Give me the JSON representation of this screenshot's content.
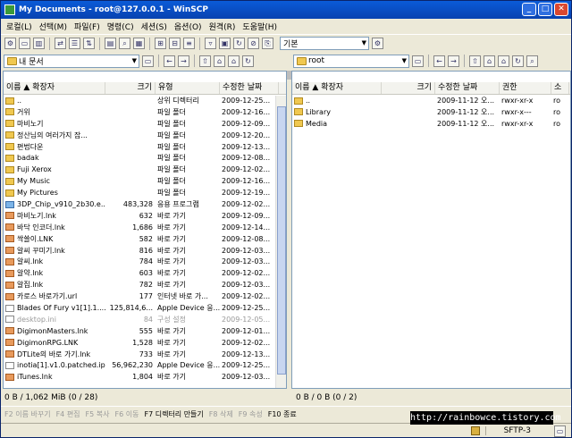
{
  "window": {
    "title": "My Documents - root@127.0.0.1 - WinSCP"
  },
  "menu": [
    "로컬(L)",
    "선택(M)",
    "파일(F)",
    "명령(C)",
    "세션(S)",
    "옵션(O)",
    "원격(R)",
    "도움말(H)"
  ],
  "toolbar": {
    "preset_label": "기본"
  },
  "left_path": {
    "value": "내 문서"
  },
  "right_path": {
    "value": "root"
  },
  "left_panel": {
    "columns": [
      "이름",
      "확장자",
      "크기",
      "유형",
      "수정한 날짜"
    ],
    "rows": [
      {
        "name": "..",
        "size": "",
        "type": "상위 디렉터리",
        "date": "2009-12-25...",
        "icon": "up"
      },
      {
        "name": "거위",
        "size": "",
        "type": "파일 폴더",
        "date": "2009-12-16...",
        "icon": "folder"
      },
      {
        "name": "마비노기",
        "size": "",
        "type": "파일 폴더",
        "date": "2009-12-09...",
        "icon": "folder"
      },
      {
        "name": "정산님의 여러가지 잡...",
        "size": "",
        "type": "파일 폴더",
        "date": "2009-12-20...",
        "icon": "folder"
      },
      {
        "name": "편법다운",
        "size": "",
        "type": "파일 폴더",
        "date": "2009-12-13...",
        "icon": "folder"
      },
      {
        "name": "badak",
        "size": "",
        "type": "파일 폴더",
        "date": "2009-12-08...",
        "icon": "folder"
      },
      {
        "name": "Fuji Xerox",
        "size": "",
        "type": "파일 폴더",
        "date": "2009-12-02...",
        "icon": "folder"
      },
      {
        "name": "My Music",
        "size": "",
        "type": "파일 폴더",
        "date": "2009-12-16...",
        "icon": "folder"
      },
      {
        "name": "My Pictures",
        "size": "",
        "type": "파일 폴더",
        "date": "2009-12-19...",
        "icon": "folder"
      },
      {
        "name": "3DP_Chip_v910_2b30.e...",
        "size": "483,328",
        "type": "응용 프로그램",
        "date": "2009-12-02...",
        "icon": "app"
      },
      {
        "name": "마비노기.lnk",
        "size": "632",
        "type": "바로 가기",
        "date": "2009-12-09...",
        "icon": "lnk"
      },
      {
        "name": "바닥 인코더.lnk",
        "size": "1,686",
        "type": "바로 가기",
        "date": "2009-12-14...",
        "icon": "lnk"
      },
      {
        "name": "싹쓸이.LNK",
        "size": "582",
        "type": "바로 가기",
        "date": "2009-12-08...",
        "icon": "lnk"
      },
      {
        "name": "알씨 꾸미기.lnk",
        "size": "816",
        "type": "바로 가기",
        "date": "2009-12-03...",
        "icon": "lnk"
      },
      {
        "name": "알씨.lnk",
        "size": "784",
        "type": "바로 가기",
        "date": "2009-12-03...",
        "icon": "lnk"
      },
      {
        "name": "알약.lnk",
        "size": "603",
        "type": "바로 가기",
        "date": "2009-12-02...",
        "icon": "lnk"
      },
      {
        "name": "알집.lnk",
        "size": "782",
        "type": "바로 가기",
        "date": "2009-12-03...",
        "icon": "lnk"
      },
      {
        "name": "카로스 바로가기.url",
        "size": "177",
        "type": "인터넷 바로 가...",
        "date": "2009-12-02...",
        "icon": "lnk"
      },
      {
        "name": "Blades Of Fury v1[1].1....",
        "size": "125,814,6...",
        "type": "Apple Device 응...",
        "date": "2009-12-25...",
        "icon": "file"
      },
      {
        "name": "desktop.ini",
        "size": "84",
        "type": "구성 설정",
        "date": "2009-12-05...",
        "icon": "file",
        "hidden": true
      },
      {
        "name": "DigimonMasters.lnk",
        "size": "555",
        "type": "바로 가기",
        "date": "2009-12-01...",
        "icon": "lnk"
      },
      {
        "name": "DigimonRPG.LNK",
        "size": "1,528",
        "type": "바로 가기",
        "date": "2009-12-02...",
        "icon": "lnk"
      },
      {
        "name": "DTLite의 바로 가기.lnk",
        "size": "733",
        "type": "바로 가기",
        "date": "2009-12-13...",
        "icon": "lnk"
      },
      {
        "name": "inotia[1].v1.0.patched.ipa",
        "size": "56,962,230",
        "type": "Apple Device 응...",
        "date": "2009-12-25...",
        "icon": "file"
      },
      {
        "name": "iTunes.lnk",
        "size": "1,804",
        "type": "바로 가기",
        "date": "2009-12-03...",
        "icon": "lnk"
      }
    ]
  },
  "right_panel": {
    "columns": [
      "이름",
      "확장자",
      "크기",
      "수정한 날짜",
      "권한",
      "소"
    ],
    "rows": [
      {
        "name": "..",
        "date": "2009-11-12 오...",
        "perm": "rwxr-xr-x",
        "owner": "ro",
        "icon": "up"
      },
      {
        "name": "Library",
        "date": "2009-11-12 오...",
        "perm": "rwxr-x---",
        "owner": "ro",
        "icon": "folder"
      },
      {
        "name": "Media",
        "date": "2009-11-12 오...",
        "perm": "rwxr-xr-x",
        "owner": "ro",
        "icon": "folder"
      }
    ]
  },
  "status": {
    "left": "0 B / 1,062 MiB (0 / 28)",
    "right": "0 B / 0 B (0 / 2)"
  },
  "fkeys": [
    {
      "label": "F2 이름 바꾸기",
      "active": false
    },
    {
      "label": "F4 편집",
      "active": false
    },
    {
      "label": "F5 복사",
      "active": false
    },
    {
      "label": "F6 이동",
      "active": false
    },
    {
      "label": "F7 디렉터리 만들기",
      "active": true
    },
    {
      "label": "F8 삭제",
      "active": false
    },
    {
      "label": "F9 속성",
      "active": false
    },
    {
      "label": "F10 종료",
      "active": true
    }
  ],
  "bottom": {
    "protocol": "SFTP-3"
  },
  "watermark": "http://rainbowce.tistory.com"
}
